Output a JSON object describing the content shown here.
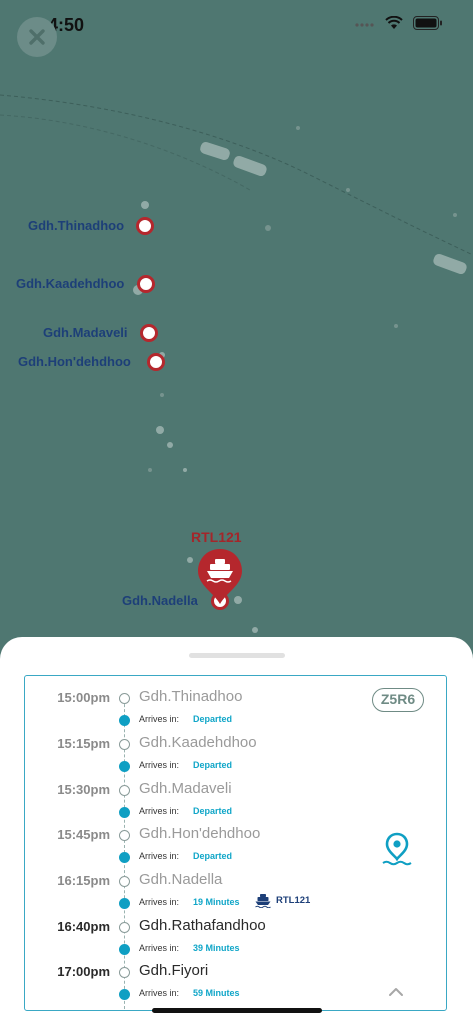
{
  "status_bar": {
    "time": "4:50"
  },
  "map": {
    "stops": [
      {
        "name": "Gdh.Thinadhoo"
      },
      {
        "name": "Gdh.Kaadehdhoo"
      },
      {
        "name": "Gdh.Madaveli"
      },
      {
        "name": "Gdh.Hon'dehdhoo"
      },
      {
        "name": "Gdh.Nadella"
      }
    ],
    "vessel_label": "RTL121",
    "colors": {
      "water": "#4f7771",
      "stop_marker": "#b5272d",
      "label": "#1d3f78"
    }
  },
  "schedule": {
    "route_code": "Z5R6",
    "arrives_label": "Arrives in:",
    "stops": [
      {
        "time": "15:00pm",
        "name": "Gdh.Thinadhoo",
        "status": "Departed",
        "upcoming": false
      },
      {
        "time": "15:15pm",
        "name": "Gdh.Kaadehdhoo",
        "status": "Departed",
        "upcoming": false
      },
      {
        "time": "15:30pm",
        "name": "Gdh.Madaveli",
        "status": "Departed",
        "upcoming": false
      },
      {
        "time": "15:45pm",
        "name": "Gdh.Hon'dehdhoo",
        "status": "Departed",
        "upcoming": false
      },
      {
        "time": "16:15pm",
        "name": "Gdh.Nadella",
        "status": "19 Minutes",
        "upcoming": false,
        "vessel": "RTL121"
      },
      {
        "time": "16:40pm",
        "name": "Gdh.Rathafandhoo",
        "status": "39 Minutes",
        "upcoming": true
      },
      {
        "time": "17:00pm",
        "name": "Gdh.Fiyori",
        "status": "59 Minutes",
        "upcoming": true
      }
    ],
    "colors": {
      "accent": "#0f9fc3",
      "card_border": "#3aa8c4",
      "vessel_text": "#1d3f78"
    }
  }
}
